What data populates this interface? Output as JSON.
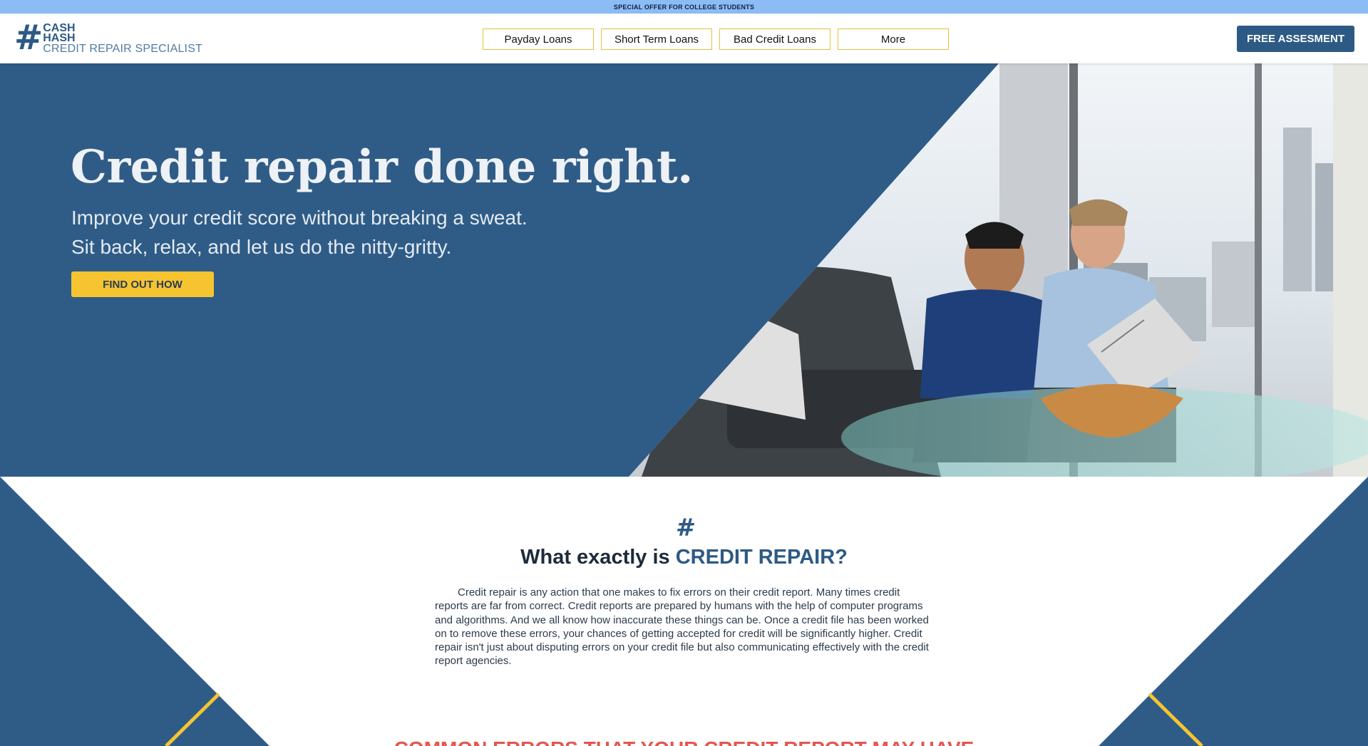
{
  "promo": {
    "text": "SPECIAL OFFER FOR COLLEGE STUDENTS"
  },
  "header": {
    "logo": {
      "line1": "CASH",
      "line2": "HASH",
      "line3": "CREDIT REPAIR SPECIALIST"
    },
    "nav": [
      {
        "label": "Payday Loans"
      },
      {
        "label": "Short Term Loans"
      },
      {
        "label": "Bad Credit Loans"
      },
      {
        "label": "More"
      }
    ],
    "cta_label": "FREE ASSESMENT"
  },
  "hero": {
    "title": "Credit repair done right.",
    "subtitle_line1": "Improve your credit score without breaking a sweat.",
    "subtitle_line2": "Sit back, relax, and let us do the nitty-gritty.",
    "button_label": "FIND OUT HOW"
  },
  "section": {
    "hash": "#",
    "title_prefix": "What exactly is ",
    "title_accent": "CREDIT REPAIR?",
    "body": "Credit repair is any action that one makes to fix errors on their credit report. Many times credit reports are far from correct. Credit reports are prepared by humans with the help of computer programs and algorithms. And we all know how inaccurate these things can be. Once a credit file has been worked on to remove these errors, your chances of getting accepted for credit will be significantly higher. Credit repair isn't just about disputing errors on your credit file but also communicating effectively with the credit report agencies.",
    "next_heading": "COMMON ERRORS THAT YOUR CREDIT REPORT MAY HAVE"
  },
  "colors": {
    "brand_blue": "#2f5c87",
    "accent_yellow": "#f5c430",
    "promo_blue": "#8cbcf5",
    "next_heading_red": "#e4574e"
  }
}
